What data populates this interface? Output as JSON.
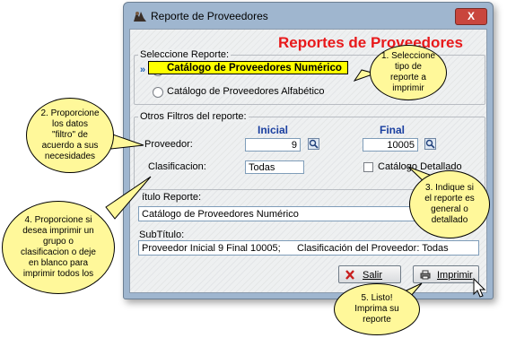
{
  "window": {
    "title": "Reporte de Proveedores",
    "close_label": "X"
  },
  "heading": "Reportes de Proveedores",
  "report_group": {
    "label": "Seleccione Reporte:",
    "marker": "»",
    "options": [
      {
        "label": "Catálogo de Proveedores Numérico",
        "selected": true
      },
      {
        "label": "Catálogo de Proveedores Alfabético",
        "selected": false
      }
    ]
  },
  "filters": {
    "label": "Otros Filtros del reporte:",
    "col_initial": "Inicial",
    "col_final": "Final",
    "supplier_label": "Proveedor:",
    "supplier_initial": "9",
    "supplier_final": "10005",
    "class_label": "Clasificacion:",
    "class_value": "Todas",
    "detailed_label": "Catálogo Detallado",
    "detailed_checked": false
  },
  "report_title": {
    "label": "ítulo Reporte:",
    "value": "Catálogo de Proveedores Numérico"
  },
  "subtitle": {
    "label": "SubTítulo:",
    "value": "Proveedor Inicial 9 Final 10005;      Clasificación del Proveedor: Todas"
  },
  "buttons": {
    "exit": "Salir",
    "exit_hotkey": "S",
    "print": "Imprimir",
    "print_hotkey": "I"
  },
  "callouts": {
    "c1": [
      "1. Seleccione",
      "tipo de",
      "reporte a",
      "imprimir"
    ],
    "c2": [
      "2. Proporcione",
      "los datos",
      "\"filtro\" de",
      "acuerdo a sus",
      "necesidades"
    ],
    "c3": [
      "3. Indique si",
      "el reporte es",
      "general o",
      "detallado"
    ],
    "c4": [
      "4. Proporcione si",
      "desea imprimir un",
      "grupo o",
      "clasificacion o deje",
      "en blanco para",
      "imprimir todos los"
    ],
    "c5": [
      "5. Listo!",
      "Imprima su",
      "reporte"
    ]
  },
  "colors": {
    "heading": "#e8191b",
    "highlight": "#ffff00",
    "callout": "#fff89a",
    "column_head": "#1a3fa0"
  }
}
